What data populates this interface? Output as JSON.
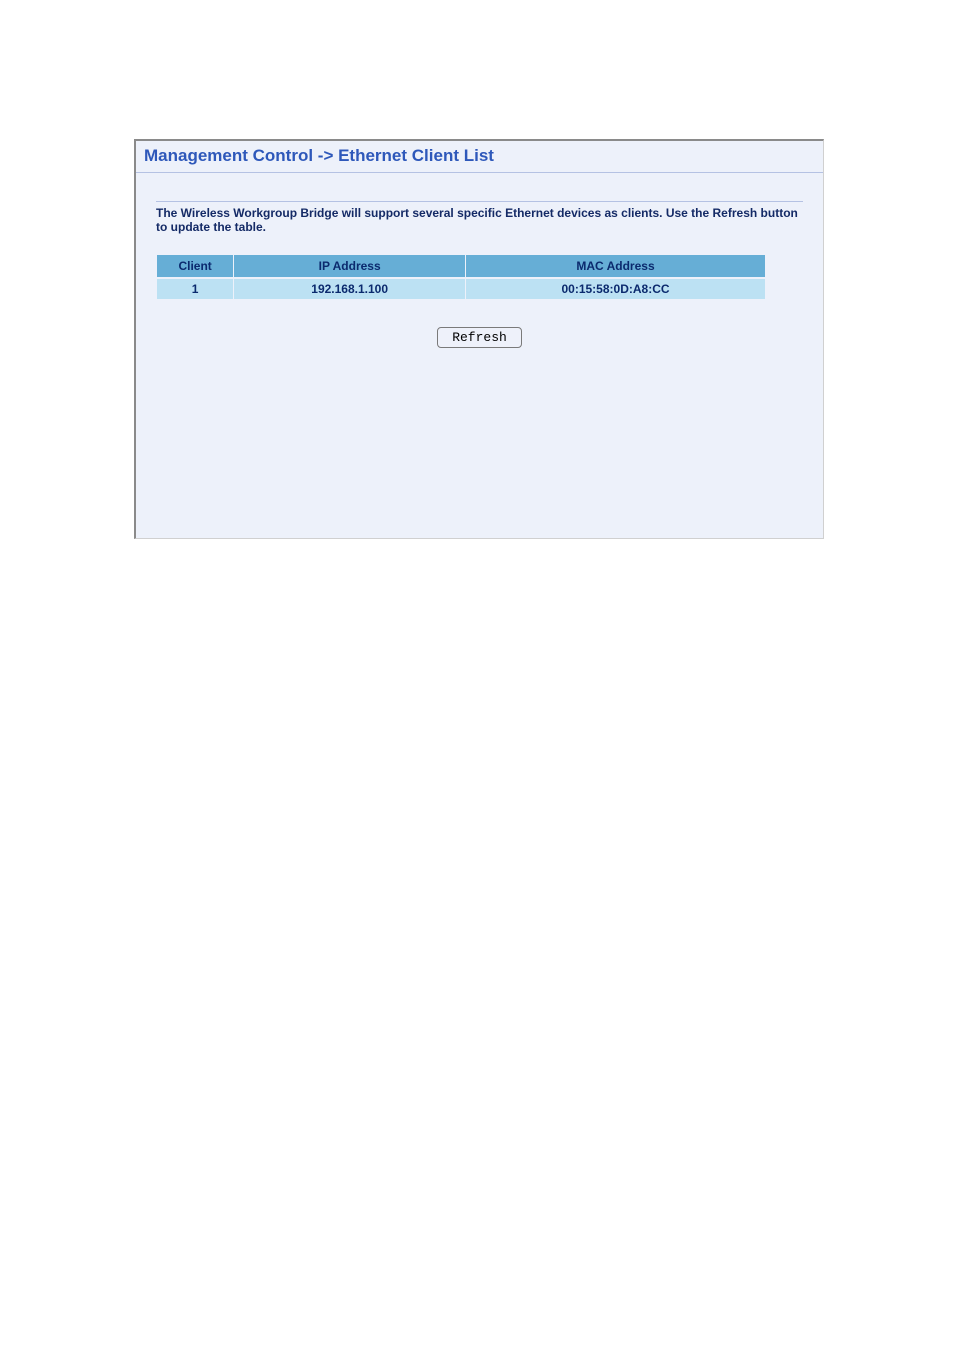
{
  "title": "Management Control -> Ethernet Client List",
  "description": "The Wireless Workgroup Bridge will support several specific Ethernet devices as clients. Use the Refresh button to update the table.",
  "table": {
    "headers": {
      "client": "Client",
      "ip": "IP Address",
      "mac": "MAC Address"
    },
    "rows": [
      {
        "client": "1",
        "ip": "192.168.1.100",
        "mac": "00:15:58:0D:A8:CC"
      }
    ]
  },
  "buttons": {
    "refresh": "Refresh"
  }
}
